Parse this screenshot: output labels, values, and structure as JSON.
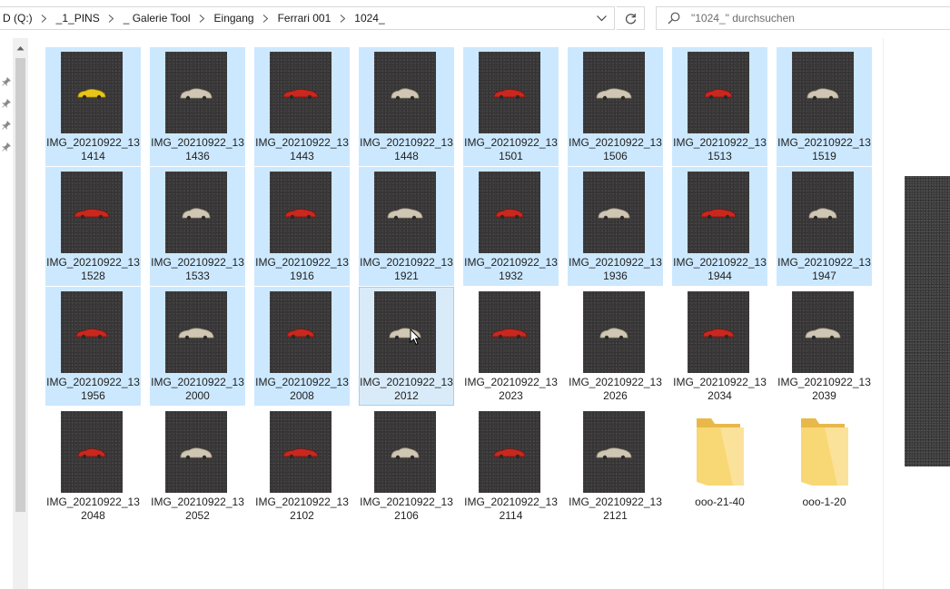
{
  "breadcrumb": {
    "items": [
      "D (Q:)",
      "_1_PINS",
      "_ Galerie Tool",
      "Eingang",
      "Ferrari 001",
      "1024_"
    ]
  },
  "search": {
    "placeholder": "\"1024_\" durchsuchen"
  },
  "files": [
    {
      "line1": "IMG_20210922_13",
      "line2": "1414",
      "pin": "yellow",
      "selected": true
    },
    {
      "line1": "IMG_20210922_13",
      "line2": "1436",
      "pin": "silver",
      "selected": true
    },
    {
      "line1": "IMG_20210922_13",
      "line2": "1443",
      "pin": "red",
      "selected": true
    },
    {
      "line1": "IMG_20210922_13",
      "line2": "1448",
      "pin": "silver",
      "selected": true
    },
    {
      "line1": "IMG_20210922_13",
      "line2": "1501",
      "pin": "red",
      "selected": true
    },
    {
      "line1": "IMG_20210922_13",
      "line2": "1506",
      "pin": "silver",
      "selected": true
    },
    {
      "line1": "IMG_20210922_13",
      "line2": "1513",
      "pin": "red",
      "selected": true
    },
    {
      "line1": "IMG_20210922_13",
      "line2": "1519",
      "pin": "silver",
      "selected": true
    },
    {
      "line1": "IMG_20210922_13",
      "line2": "1528",
      "pin": "red",
      "selected": true
    },
    {
      "line1": "IMG_20210922_13",
      "line2": "1533",
      "pin": "silver",
      "selected": true
    },
    {
      "line1": "IMG_20210922_13",
      "line2": "1916",
      "pin": "red",
      "selected": true
    },
    {
      "line1": "IMG_20210922_13",
      "line2": "1921",
      "pin": "silver",
      "selected": true
    },
    {
      "line1": "IMG_20210922_13",
      "line2": "1932",
      "pin": "red",
      "selected": true
    },
    {
      "line1": "IMG_20210922_13",
      "line2": "1936",
      "pin": "silver",
      "selected": true
    },
    {
      "line1": "IMG_20210922_13",
      "line2": "1944",
      "pin": "red",
      "selected": true
    },
    {
      "line1": "IMG_20210922_13",
      "line2": "1947",
      "pin": "silver",
      "selected": true
    },
    {
      "line1": "IMG_20210922_13",
      "line2": "1956",
      "pin": "red",
      "selected": true
    },
    {
      "line1": "IMG_20210922_13",
      "line2": "2000",
      "pin": "silver",
      "selected": true
    },
    {
      "line1": "IMG_20210922_13",
      "line2": "2008",
      "pin": "red",
      "selected": true
    },
    {
      "line1": "IMG_20210922_13",
      "line2": "2012",
      "pin": "silver",
      "selected": true,
      "focused": true
    },
    {
      "line1": "IMG_20210922_13",
      "line2": "2023",
      "pin": "red",
      "selected": false
    },
    {
      "line1": "IMG_20210922_13",
      "line2": "2026",
      "pin": "silver",
      "selected": false
    },
    {
      "line1": "IMG_20210922_13",
      "line2": "2034",
      "pin": "red",
      "selected": false
    },
    {
      "line1": "IMG_20210922_13",
      "line2": "2039",
      "pin": "silver",
      "selected": false
    },
    {
      "line1": "IMG_20210922_13",
      "line2": "2048",
      "pin": "red",
      "selected": false
    },
    {
      "line1": "IMG_20210922_13",
      "line2": "2052",
      "pin": "silver",
      "selected": false
    },
    {
      "line1": "IMG_20210922_13",
      "line2": "2102",
      "pin": "red",
      "selected": false
    },
    {
      "line1": "IMG_20210922_13",
      "line2": "2106",
      "pin": "silver",
      "selected": false
    },
    {
      "line1": "IMG_20210922_13",
      "line2": "2114",
      "pin": "red",
      "selected": false
    },
    {
      "line1": "IMG_20210922_13",
      "line2": "2121",
      "pin": "silver",
      "selected": false
    }
  ],
  "folders": [
    {
      "name": "ooo-21-40"
    },
    {
      "name": "ooo-1-20"
    }
  ],
  "colors": {
    "selection": "#cce8ff",
    "focus_border": "#99d1ff",
    "pin_yellow": "#e8c619",
    "pin_red": "#c8281e",
    "pin_silver": "#cfc6b3",
    "folder": "#f8d775"
  }
}
